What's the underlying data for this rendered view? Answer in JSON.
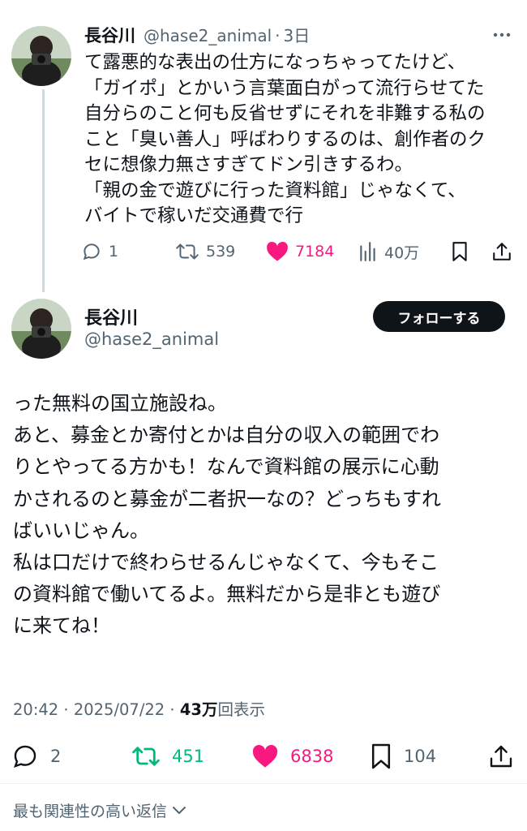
{
  "tweet1": {
    "name": "長谷川",
    "handle": "@hase2_animal",
    "separator": "·",
    "time": "3日",
    "text": "て露悪的な表出の仕方になっちゃってたけど、\n「ガイポ」とかいう言葉面白がって流行らせてた\n自分らのこと何も反省せずにそれを非難する私の\nこと「臭い善人」呼ばわりするのは、創作者のク\nセに想像力無さすぎてドン引きするわ。\n「親の金で遊びに行った資料館」じゃなくて、\nバイトで稼いだ交通費で行",
    "replies": "1",
    "retweets": "539",
    "likes": "7184",
    "views": "40万"
  },
  "tweet2": {
    "name": "長谷川",
    "handle": "@hase2_animal",
    "follow_label": "フォローする",
    "text": "った無料の国立施設ね。\nあと、募金とか寄付とかは自分の収入の範囲でわ\nりとやってる方かも！なんで資料館の展示に心動\nかされるのと募金が二者択一なの？どっちもすれ\nばいいじゃん。\n私は口だけで終わらせるんじゃなくて、今もそこ\nの資料館で働いてるよ。無料だから是非とも遊び\nに来てね！",
    "time": "20:42",
    "date": "2025/07/22",
    "separator": "·",
    "views_count": "43万",
    "views_label": "回表示",
    "replies": "2",
    "retweets": "451",
    "likes": "6838",
    "bookmarks": "104"
  },
  "replies_sort_label": "最も関連性の高い返信",
  "colors": {
    "like": "#f91880",
    "retweet": "#00ba7c",
    "muted": "#536471",
    "text": "#0f1419"
  }
}
